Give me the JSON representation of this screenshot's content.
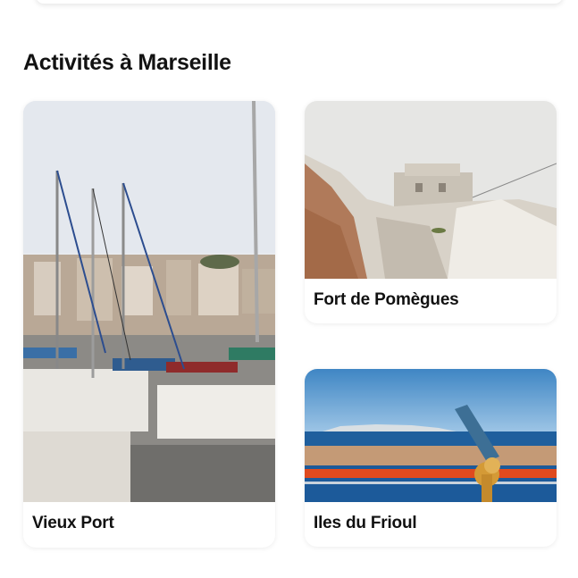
{
  "section": {
    "title": "Activités à Marseille"
  },
  "cards": [
    {
      "label": "Vieux Port",
      "image": "marina-sailboats-photo"
    },
    {
      "label": "Fort de Pomègues",
      "image": "fort-on-rocky-island-photo"
    },
    {
      "label": "Iles du Frioul",
      "image": "sea-islands-telescope-photo"
    }
  ]
}
